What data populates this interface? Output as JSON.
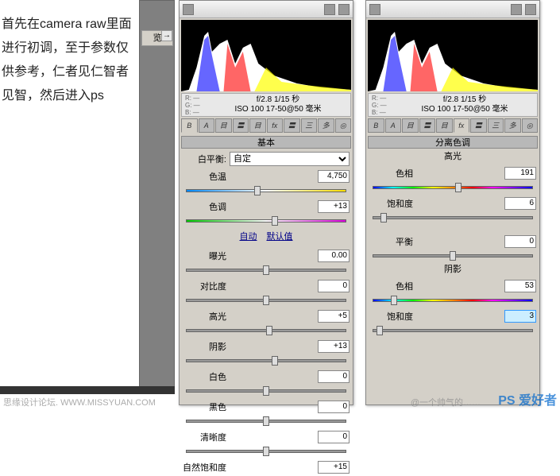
{
  "tutorial": "首先在camera raw里面进行初调，至于参数仅供参考，仁者见仁智者见智，然后进入ps",
  "gray": {
    "tab": "览",
    "expand": "→"
  },
  "camera": {
    "rgb": "R: —\nG: —\nB: —",
    "line1": "f/2.8  1/15 秒",
    "line2": "ISO 100  17-50@50 毫米"
  },
  "tabs": [
    "B",
    "A",
    "目",
    "〓",
    "目",
    "fx",
    "〓",
    "三",
    "多",
    "◎"
  ],
  "sect": {
    "basic": "基本",
    "split": "分离色调",
    "high": "高光",
    "shadow": "阴影"
  },
  "wb": {
    "label": "白平衡:",
    "value": "自定"
  },
  "links": {
    "auto": "自动",
    "def": "默认值"
  },
  "sl": {
    "temp": {
      "l": "色温",
      "v": "4,750"
    },
    "tint": {
      "l": "色调",
      "v": "+13"
    },
    "exp": {
      "l": "曝光",
      "v": "0.00"
    },
    "con": {
      "l": "对比度",
      "v": "0"
    },
    "hig": {
      "l": "高光",
      "v": "+5"
    },
    "sha": {
      "l": "阴影",
      "v": "+13"
    },
    "whi": {
      "l": "白色",
      "v": "0"
    },
    "bla": {
      "l": "黑色",
      "v": "0"
    },
    "cla": {
      "l": "清晰度",
      "v": "0"
    },
    "sat": {
      "l": "自然饱和度",
      "v": "+15"
    },
    "hHue": {
      "l": "色相",
      "v": "191"
    },
    "hSat": {
      "l": "饱和度",
      "v": "6"
    },
    "bal": {
      "l": "平衡",
      "v": "0"
    },
    "sHue": {
      "l": "色相",
      "v": "53"
    },
    "sSat": {
      "l": "饱和度",
      "v": "3"
    }
  },
  "wm": {
    "left": "思缘设计论坛. WWW.MISSYUAN.COM",
    "weibo": "@一个帅气的……",
    "logo": "PS 爱好者"
  }
}
